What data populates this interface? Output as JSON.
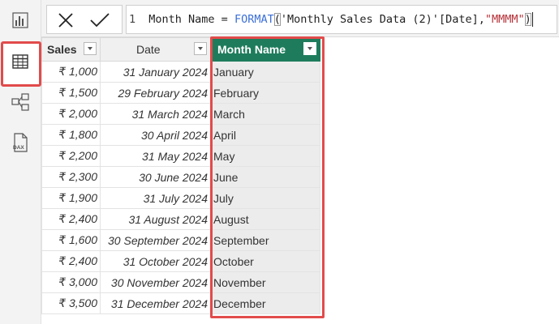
{
  "formula_bar": {
    "line_number": "1",
    "formula_prefix": "Month Name = ",
    "formula_function": "FORMAT",
    "formula_open_paren": "(",
    "formula_arg_ref": "'Monthly Sales Data (2)'[Date],",
    "formula_format_string": "\"MMMM\"",
    "formula_close_paren": ")"
  },
  "rail": {
    "items": [
      "report-view-icon",
      "table-view-icon",
      "model-view-icon",
      "dax-query-view-icon"
    ],
    "active": "table-view-icon",
    "dax_label": "DAX"
  },
  "table": {
    "columns": [
      "Sales",
      "Date",
      "Month Name"
    ],
    "rows": [
      {
        "sales": "₹ 1,000",
        "date": "31 January 2024",
        "month": "January"
      },
      {
        "sales": "₹ 1,500",
        "date": "29 February 2024",
        "month": "February"
      },
      {
        "sales": "₹ 2,000",
        "date": "31 March 2024",
        "month": "March"
      },
      {
        "sales": "₹ 1,800",
        "date": "30 April 2024",
        "month": "April"
      },
      {
        "sales": "₹ 2,200",
        "date": "31 May 2024",
        "month": "May"
      },
      {
        "sales": "₹ 2,300",
        "date": "30 June 2024",
        "month": "June"
      },
      {
        "sales": "₹ 1,900",
        "date": "31 July 2024",
        "month": "July"
      },
      {
        "sales": "₹ 2,400",
        "date": "31 August 2024",
        "month": "August"
      },
      {
        "sales": "₹ 1,600",
        "date": "30 September 2024",
        "month": "September"
      },
      {
        "sales": "₹ 2,400",
        "date": "31 October 2024",
        "month": "October"
      },
      {
        "sales": "₹ 3,000",
        "date": "30 November 2024",
        "month": "November"
      },
      {
        "sales": "₹ 3,500",
        "date": "31 December 2024",
        "month": "December"
      }
    ]
  },
  "colors": {
    "accent_header": "#1e7c5c",
    "highlight": "#e24b4b"
  }
}
